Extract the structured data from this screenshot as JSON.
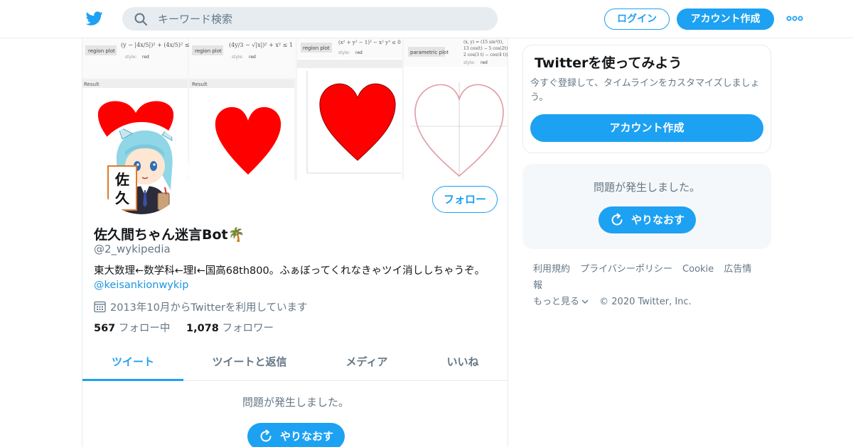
{
  "nav": {
    "search_placeholder": "キーワード検索",
    "login_label": "ログイン",
    "signup_label": "アカウント作成"
  },
  "header_images": {
    "panel1": {
      "label": "region plot",
      "result": "Result",
      "style": "style:",
      "style_value": "red"
    },
    "panel2": {
      "label": "region plot",
      "result": "Result",
      "style": "style:",
      "style_value": "red"
    },
    "panel3": {
      "formula": "(x² + y² − 1)³ − x² y³ ≤ 0",
      "label": "region plot",
      "style": "style:",
      "style_value": "red"
    },
    "panel4": {
      "label": "parametric plot",
      "style": "style:",
      "style_value": "red"
    }
  },
  "profile": {
    "name": "佐久間ちゃん迷言Bot🌴",
    "handle": "@2_wykipedia",
    "bio": "東大数理←数学科←理I←国高68th800。ふぁぼってくれなきゃツイ消ししちゃうぞ。",
    "bio_link": "@keisankionwykip",
    "joined": "2013年10月からTwitterを利用しています",
    "following_count": "567",
    "following_label": "フォロー中",
    "followers_count": "1,078",
    "followers_label": "フォロワー",
    "follow_label": "フォロー",
    "avatar_sign": "佐久"
  },
  "tabs": [
    "ツイート",
    "ツイートと返信",
    "メディア",
    "いいね"
  ],
  "timeline": {
    "error": "問題が発生しました。",
    "retry_label": "やりなおす"
  },
  "sidebar": {
    "card_title": "Twitterを使ってみよう",
    "card_desc": "今すぐ登録して、タイムラインをカスタマイズしましょう。",
    "card_button": "アカウント作成",
    "error": "問題が発生しました。",
    "retry_label": "やりなおす"
  },
  "footer": {
    "links": [
      "利用規約",
      "プライバシーポリシー",
      "Cookie",
      "広告情報"
    ],
    "more": "もっと見る",
    "copyright": "© 2020 Twitter, Inc."
  },
  "colors": {
    "accent": "#1da1f2",
    "heart": "#ff0000",
    "text_secondary": "#657786"
  }
}
